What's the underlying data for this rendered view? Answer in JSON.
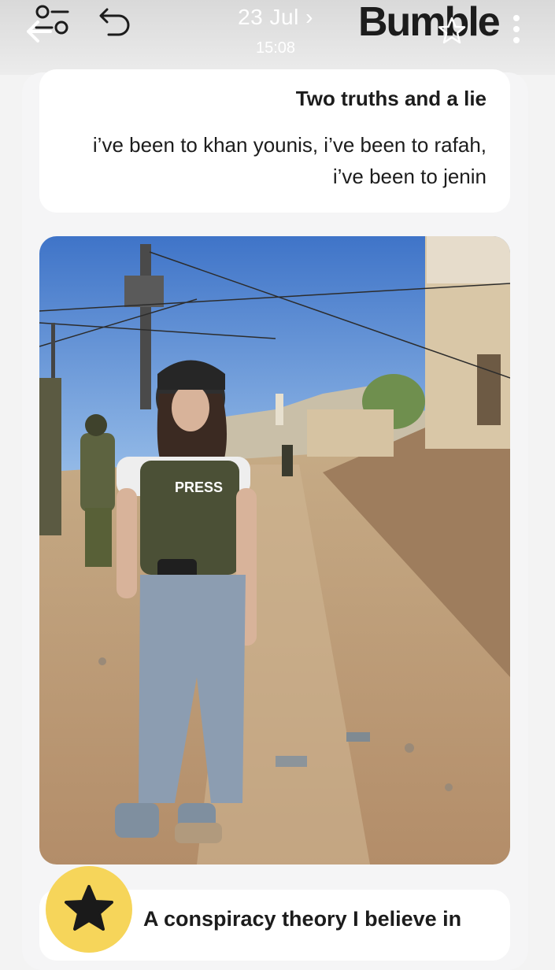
{
  "status": {
    "date": "23 Jul ›",
    "time": "15:08"
  },
  "app": {
    "brand": "Bumble"
  },
  "icons": {
    "back": "back-arrow-icon",
    "filters": "filters-icon",
    "undo": "undo-icon",
    "favorite": "star-outline-icon",
    "more": "more-vertical-icon",
    "superswipe": "star-icon"
  },
  "prompts": [
    {
      "title": "Two truths and a lie",
      "answer": "i’ve been to khan younis, i’ve been to rafah, i’ve been to jenin"
    },
    {
      "title": "A conspiracy theory I believe in"
    }
  ],
  "photo": {
    "vest_label": "PRESS"
  },
  "colors": {
    "brand_yellow": "#f6d55a",
    "card_bg": "#ffffff",
    "page_bg": "#f3f3f3"
  }
}
